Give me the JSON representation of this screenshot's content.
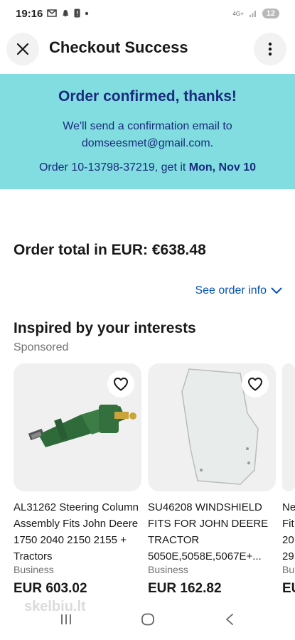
{
  "status_bar": {
    "time": "19:16",
    "network": "4G+",
    "notification_count": "12"
  },
  "header": {
    "title": "Checkout Success"
  },
  "banner": {
    "title": "Order confirmed, thanks!",
    "line1": "We'll send a confirmation email to",
    "email": "domseesmet@gmail.com.",
    "order_prefix": "Order 10-13798-37219, get it",
    "delivery_date": "Mon, Nov 10"
  },
  "order_total": "Order total in EUR: €638.48",
  "see_order_info": "See order info",
  "section": {
    "title": "Inspired by your interests",
    "sponsored": "Sponsored"
  },
  "products": [
    {
      "title": "AL31262 Steering Column Assembly Fits John Deere 1750 2040 2150 2155 + Tractors",
      "seller": "Business",
      "price": "EUR 603.02"
    },
    {
      "title": "SU46208 WINDSHIELD FITS FOR JOHN DEERE TRACTOR 5050E,5058E,5067E+...",
      "seller": "Business",
      "price": "EUR 162.82"
    },
    {
      "title": "Ne Fit 20 29",
      "seller": "Bu",
      "price": "EU"
    }
  ],
  "watermark": "skelbiu.lt",
  "colors": {
    "banner_bg": "#82dde0",
    "banner_text": "#1b2b7e",
    "link": "#0654ba"
  }
}
